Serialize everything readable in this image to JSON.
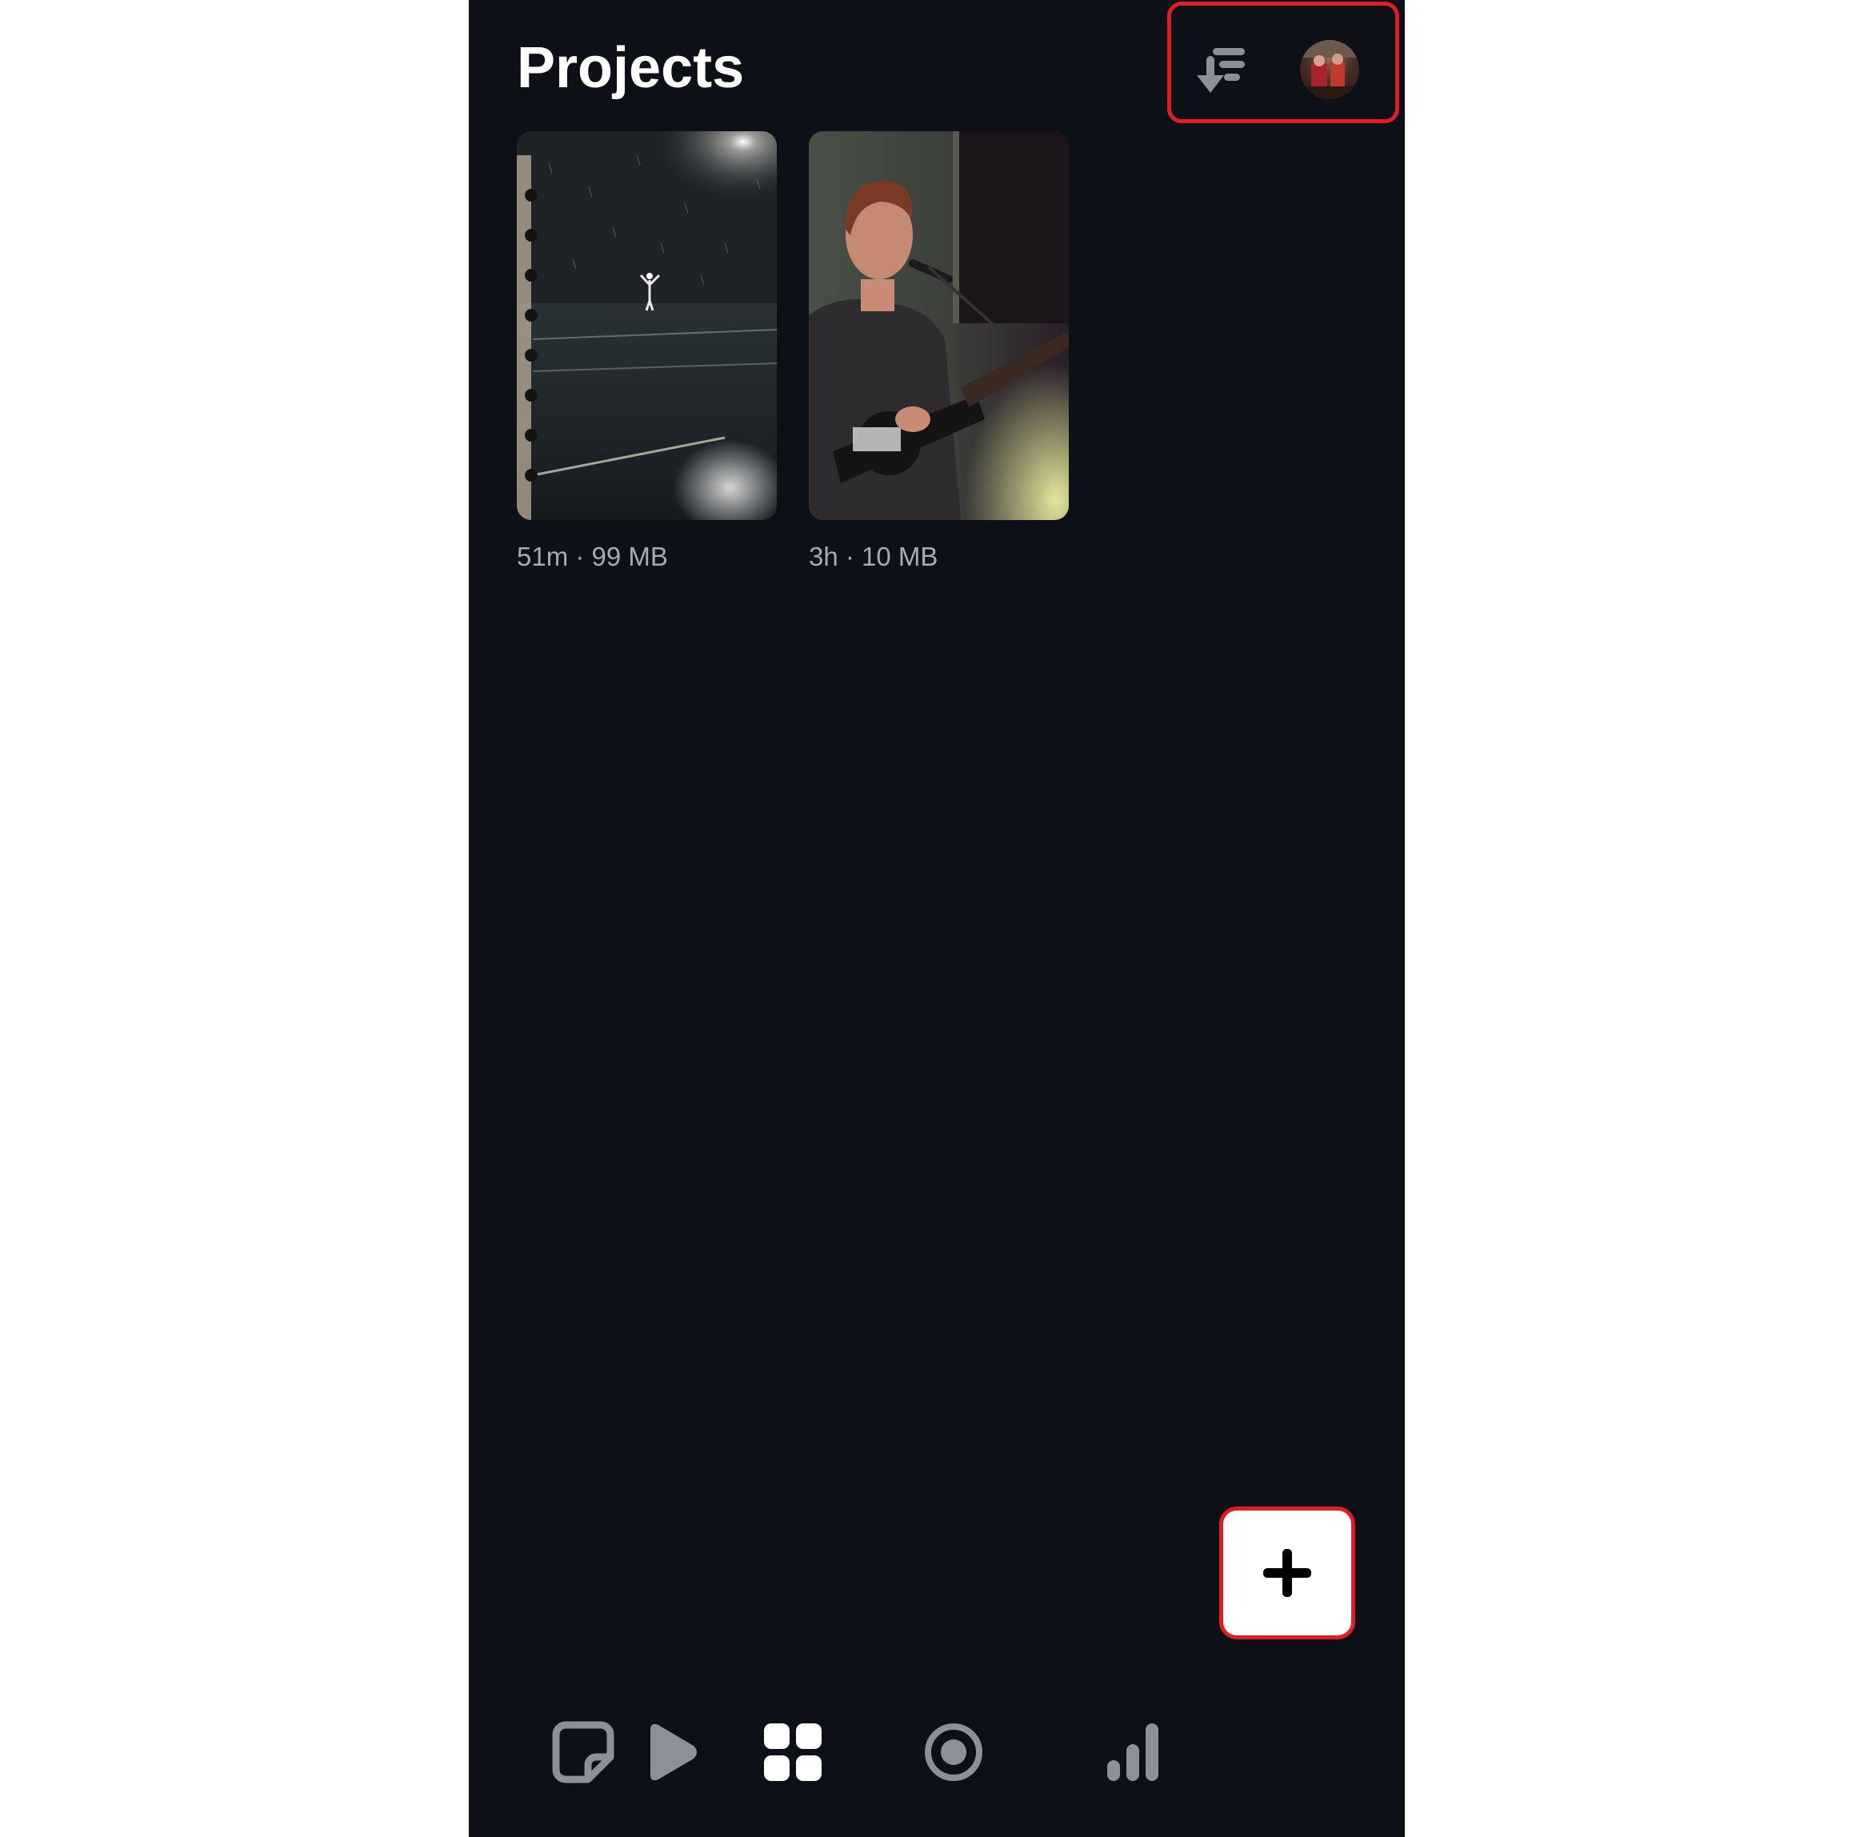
{
  "header": {
    "title": "Projects",
    "sort_icon": "sort-arrow-icon",
    "avatar_icon": "user-avatar"
  },
  "projects": [
    {
      "meta": "51m · 99 MB",
      "thumbnail": "rainy-night-field"
    },
    {
      "meta": "3h · 10 MB",
      "thumbnail": "guitarist-singing"
    }
  ],
  "fab": {
    "icon": "plus-icon"
  },
  "tabbar": {
    "items": [
      {
        "name": "notes",
        "icon": "sticky-note-icon",
        "active": false
      },
      {
        "name": "play",
        "icon": "play-icon",
        "active": false
      },
      {
        "name": "projects",
        "icon": "grid-icon",
        "active": true
      },
      {
        "name": "record",
        "icon": "record-icon",
        "active": false
      },
      {
        "name": "stats",
        "icon": "bar-chart-icon",
        "active": false
      }
    ]
  },
  "colors": {
    "background": "#0d1117",
    "highlight": "#e21c25",
    "icon_inactive": "#8b9099",
    "icon_active": "#ffffff",
    "meta_text": "#a7abb3"
  }
}
